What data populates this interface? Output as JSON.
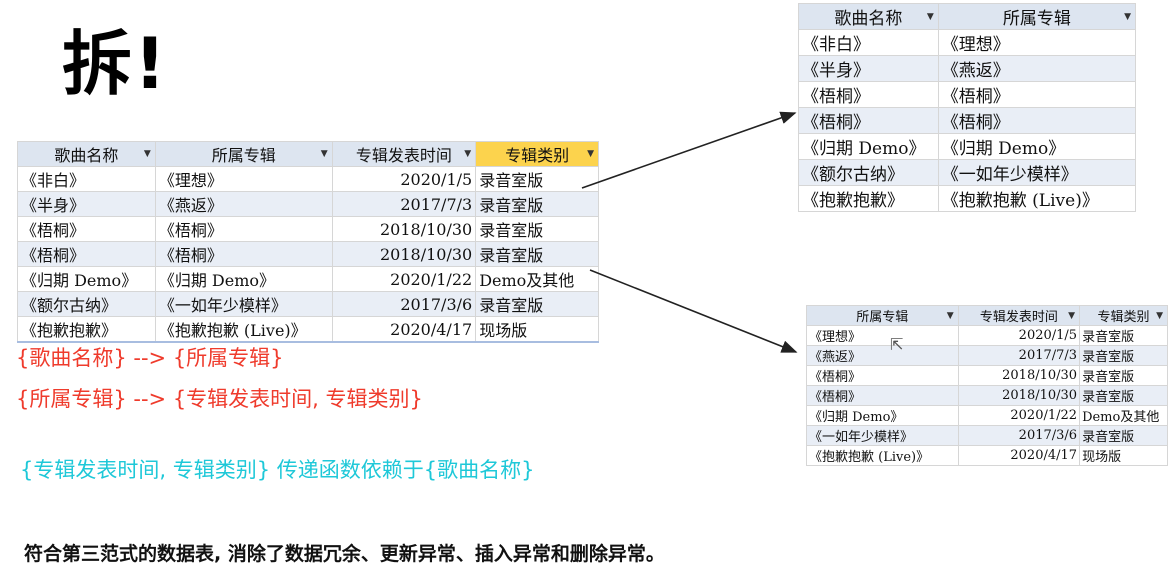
{
  "title": "拆!",
  "main_table": {
    "headers": [
      "歌曲名称",
      "所属专辑",
      "专辑发表时间",
      "专辑类别"
    ],
    "rows": [
      [
        "《非白》",
        "《理想》",
        "2020/1/5",
        "录音室版"
      ],
      [
        "《半身》",
        "《燕返》",
        "2017/7/3",
        "录音室版"
      ],
      [
        "《梧桐》",
        "《梧桐》",
        "2018/10/30",
        "录音室版"
      ],
      [
        "《梧桐》",
        "《梧桐》",
        "2018/10/30",
        "录音室版"
      ],
      [
        "《归期 Demo》",
        "《归期 Demo》",
        "2020/1/22",
        "Demo及其他"
      ],
      [
        "《额尔古纳》",
        "《一如年少模样》",
        "2017/3/6",
        "录音室版"
      ],
      [
        "《抱歉抱歉》",
        "《抱歉抱歉 (Live)》",
        "2020/4/17",
        "现场版"
      ]
    ]
  },
  "song_album_table": {
    "headers": [
      "歌曲名称",
      "所属专辑"
    ],
    "rows": [
      [
        "《非白》",
        "《理想》"
      ],
      [
        "《半身》",
        "《燕返》"
      ],
      [
        "《梧桐》",
        "《梧桐》"
      ],
      [
        "《梧桐》",
        "《梧桐》"
      ],
      [
        "《归期 Demo》",
        "《归期 Demo》"
      ],
      [
        "《额尔古纳》",
        "《一如年少模样》"
      ],
      [
        "《抱歉抱歉》",
        "《抱歉抱歉 (Live)》"
      ]
    ]
  },
  "album_table": {
    "headers": [
      "所属专辑",
      "专辑发表时间",
      "专辑类别"
    ],
    "rows": [
      [
        "《理想》",
        "2020/1/5",
        "录音室版"
      ],
      [
        "《燕返》",
        "2017/7/3",
        "录音室版"
      ],
      [
        "《梧桐》",
        "2018/10/30",
        "录音室版"
      ],
      [
        "《梧桐》",
        "2018/10/30",
        "录音室版"
      ],
      [
        "《归期 Demo》",
        "2020/1/22",
        "Demo及其他"
      ],
      [
        "《一如年少模样》",
        "2017/3/6",
        "录音室版"
      ],
      [
        "《抱歉抱歉 (Live)》",
        "2020/4/17",
        "现场版"
      ]
    ]
  },
  "dependencies": [
    "{歌曲名称} --> {所属专辑}",
    "{所属专辑} --> {专辑发表时间, 专辑类别}"
  ],
  "transitive": "{专辑发表时间, 专辑类别} 传递函数依赖于{歌曲名称}",
  "conclusion": "符合第三范式的数据表, 消除了数据冗余、更新异常、插入异常和删除异常。",
  "colors": {
    "dependency": "#ef3b2c",
    "transitive": "#1ec8d8",
    "header": "#dde5f0",
    "highlight_header": "#fcd34d"
  },
  "icons": {
    "filter_dropdown": "dropdown-arrow-icon",
    "cursor": "mouse-cursor-icon"
  }
}
